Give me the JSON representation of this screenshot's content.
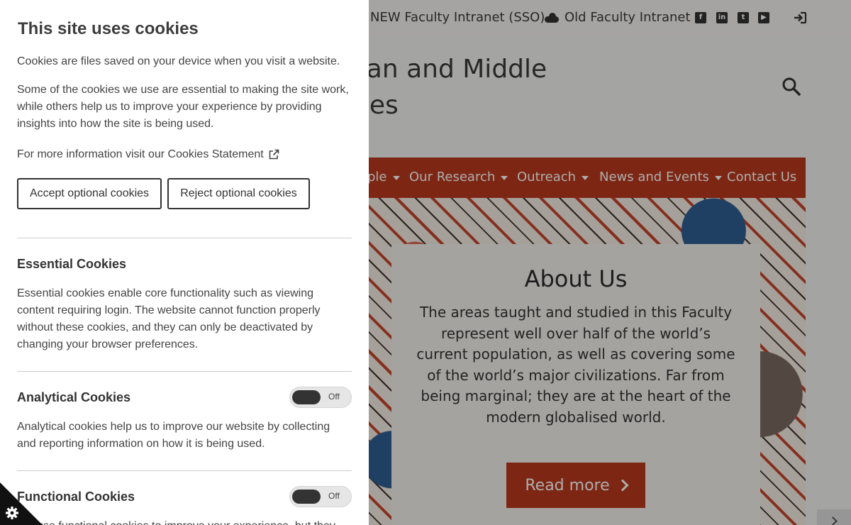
{
  "utility": {
    "new_intranet": "NEW Faculty Intranet (SSO)",
    "old_intranet": "Old Faculty Intranet",
    "social": [
      "f",
      "in",
      "t",
      "▶"
    ]
  },
  "site": {
    "title_line1": "sian and Middle",
    "title_line2": "dies"
  },
  "nav": {
    "people": "ple",
    "research": "Our Research",
    "outreach": "Outreach",
    "news": "News and Events",
    "contact": "Contact Us"
  },
  "hero": {
    "heading": "About Us",
    "body": "The areas taught and studied in this Faculty represent well over half of the world’s current population, as well as covering some of the world’s major civilizations. Far from being marginal; they are at the heart of the modern globalised world.",
    "button": "Read more"
  },
  "cookies": {
    "title": "This site uses cookies",
    "intro": "Cookies are files saved on your device when you visit a website.",
    "explain": "Some of the cookies we use are essential to making the site work, while others help us to improve your experience by providing insights into how the site is being used.",
    "more_info": "For more information visit our Cookies Statement",
    "accept_label": "Accept optional cookies",
    "reject_label": "Reject optional cookies",
    "essential": {
      "heading": "Essential Cookies",
      "text": "Essential cookies enable core functionality such as viewing content requiring login. The website cannot function properly without these cookies, and they can only be deactivated by changing your browser preferences."
    },
    "analytical": {
      "heading": "Analytical Cookies",
      "text": "Analytical cookies help us to improve our website by collecting and reporting information on how it is being used.",
      "toggle_state": "Off"
    },
    "functional": {
      "heading": "Functional Cookies",
      "text": "We use functional cookies to improve your experience, but they",
      "toggle_state": "Off"
    }
  },
  "colors": {
    "brand_red": "#b9391d",
    "panel_bg": "#ffffff",
    "overlay": "rgba(0,0,0,0.32)"
  }
}
